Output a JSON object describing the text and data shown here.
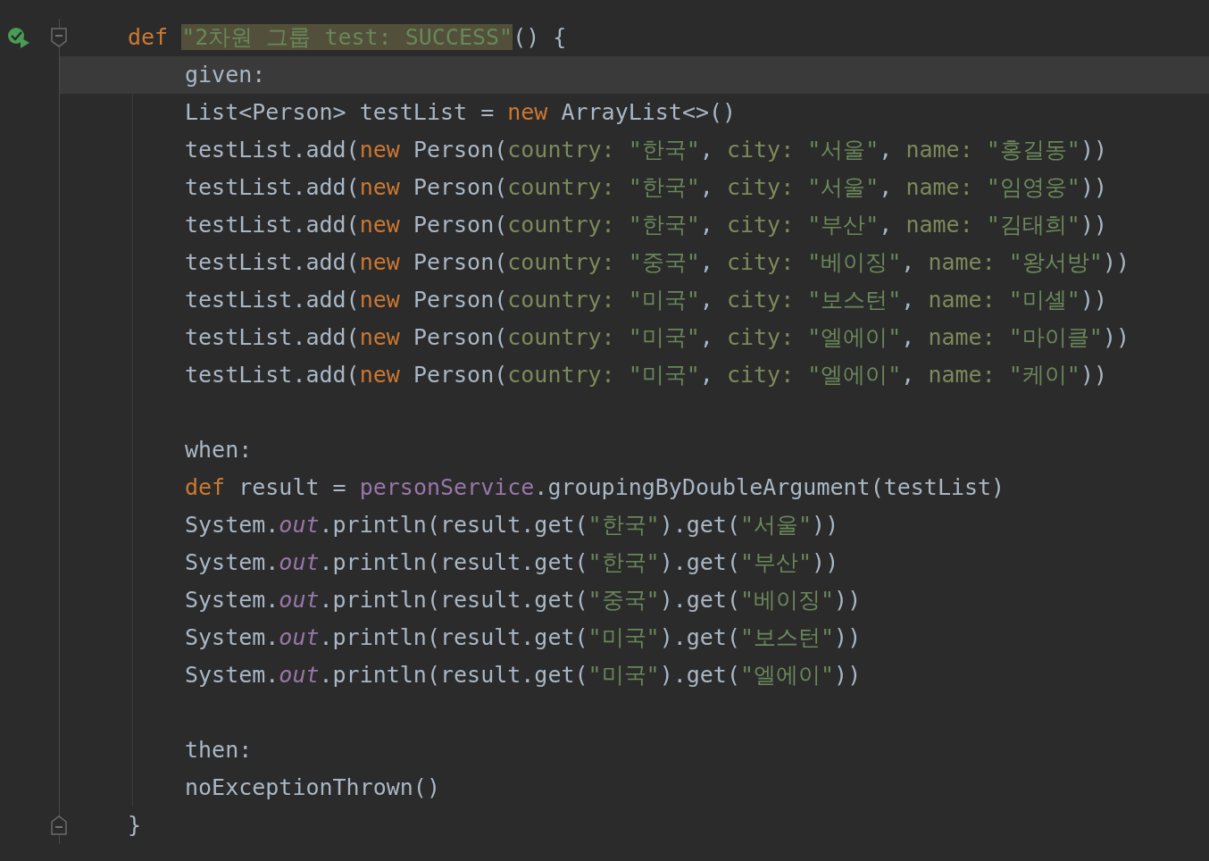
{
  "editor": {
    "lines": [
      {
        "kind": "block-start",
        "current": false,
        "tokens": [
          {
            "kind": "keyword",
            "text": "def"
          },
          {
            "kind": "highlighted-string",
            "text": "\"2차원 그룹 test: SUCCESS\""
          },
          {
            "kind": "plain",
            "text": "() {"
          }
        ],
        "children": [
          {
            "current": true,
            "tokens": [
              {
                "kind": "plain",
                "text": "given:"
              }
            ]
          },
          {
            "current": false,
            "tokens": [
              {
                "kind": "plain",
                "text": "List<Person> testList = "
              },
              {
                "kind": "keyword",
                "text": "new"
              },
              {
                "kind": "plain",
                "text": " ArrayList<>()"
              }
            ]
          },
          {
            "current": false,
            "tokens": [
              {
                "kind": "plain",
                "text": "testList.add("
              },
              {
                "kind": "keyword",
                "text": "new"
              },
              {
                "kind": "plain",
                "text": " Person("
              },
              {
                "kind": "param",
                "text": "country:"
              },
              {
                "kind": "string",
                "text": "\"한국\""
              },
              {
                "kind": "plain",
                "text": ", "
              },
              {
                "kind": "param",
                "text": "city:"
              },
              {
                "kind": "string",
                "text": "\"서울\""
              },
              {
                "kind": "plain",
                "text": ", "
              },
              {
                "kind": "param",
                "text": "name:"
              },
              {
                "kind": "string",
                "text": "\"홍길동\""
              },
              {
                "kind": "plain",
                "text": "))"
              }
            ]
          },
          {
            "current": false,
            "tokens": [
              {
                "kind": "plain",
                "text": "testList.add("
              },
              {
                "kind": "keyword",
                "text": "new"
              },
              {
                "kind": "plain",
                "text": " Person("
              },
              {
                "kind": "param",
                "text": "country:"
              },
              {
                "kind": "string",
                "text": "\"한국\""
              },
              {
                "kind": "plain",
                "text": ", "
              },
              {
                "kind": "param",
                "text": "city:"
              },
              {
                "kind": "string",
                "text": "\"서울\""
              },
              {
                "kind": "plain",
                "text": ", "
              },
              {
                "kind": "param",
                "text": "name:"
              },
              {
                "kind": "string",
                "text": "\"임영웅\""
              },
              {
                "kind": "plain",
                "text": "))"
              }
            ]
          },
          {
            "current": false,
            "tokens": [
              {
                "kind": "plain",
                "text": "testList.add("
              },
              {
                "kind": "keyword",
                "text": "new"
              },
              {
                "kind": "plain",
                "text": " Person("
              },
              {
                "kind": "param",
                "text": "country:"
              },
              {
                "kind": "string",
                "text": "\"한국\""
              },
              {
                "kind": "plain",
                "text": ", "
              },
              {
                "kind": "param",
                "text": "city:"
              },
              {
                "kind": "string",
                "text": "\"부산\""
              },
              {
                "kind": "plain",
                "text": ", "
              },
              {
                "kind": "param",
                "text": "name:"
              },
              {
                "kind": "string",
                "text": "\"김태희\""
              },
              {
                "kind": "plain",
                "text": "))"
              }
            ]
          },
          {
            "current": false,
            "tokens": [
              {
                "kind": "plain",
                "text": "testList.add("
              },
              {
                "kind": "keyword",
                "text": "new"
              },
              {
                "kind": "plain",
                "text": " Person("
              },
              {
                "kind": "param",
                "text": "country:"
              },
              {
                "kind": "string",
                "text": "\"중국\""
              },
              {
                "kind": "plain",
                "text": ", "
              },
              {
                "kind": "param",
                "text": "city:"
              },
              {
                "kind": "string",
                "text": "\"베이징\""
              },
              {
                "kind": "plain",
                "text": ", "
              },
              {
                "kind": "param",
                "text": "name:"
              },
              {
                "kind": "string",
                "text": "\"왕서방\""
              },
              {
                "kind": "plain",
                "text": "))"
              }
            ]
          },
          {
            "current": false,
            "tokens": [
              {
                "kind": "plain",
                "text": "testList.add("
              },
              {
                "kind": "keyword",
                "text": "new"
              },
              {
                "kind": "plain",
                "text": " Person("
              },
              {
                "kind": "param",
                "text": "country:"
              },
              {
                "kind": "string",
                "text": "\"미국\""
              },
              {
                "kind": "plain",
                "text": ", "
              },
              {
                "kind": "param",
                "text": "city:"
              },
              {
                "kind": "string",
                "text": "\"보스턴\""
              },
              {
                "kind": "plain",
                "text": ", "
              },
              {
                "kind": "param",
                "text": "name:"
              },
              {
                "kind": "string",
                "text": "\"미셸\""
              },
              {
                "kind": "plain",
                "text": "))"
              }
            ]
          },
          {
            "current": false,
            "tokens": [
              {
                "kind": "plain",
                "text": "testList.add("
              },
              {
                "kind": "keyword",
                "text": "new"
              },
              {
                "kind": "plain",
                "text": " Person("
              },
              {
                "kind": "param",
                "text": "country:"
              },
              {
                "kind": "string",
                "text": "\"미국\""
              },
              {
                "kind": "plain",
                "text": ", "
              },
              {
                "kind": "param",
                "text": "city:"
              },
              {
                "kind": "string",
                "text": "\"엘에이\""
              },
              {
                "kind": "plain",
                "text": ", "
              },
              {
                "kind": "param",
                "text": "name:"
              },
              {
                "kind": "string",
                "text": "\"마이클\""
              },
              {
                "kind": "plain",
                "text": "))"
              }
            ]
          },
          {
            "current": false,
            "tokens": [
              {
                "kind": "plain",
                "text": "testList.add("
              },
              {
                "kind": "keyword",
                "text": "new"
              },
              {
                "kind": "plain",
                "text": " Person("
              },
              {
                "kind": "param",
                "text": "country:"
              },
              {
                "kind": "string",
                "text": "\"미국\""
              },
              {
                "kind": "plain",
                "text": ", "
              },
              {
                "kind": "param",
                "text": "city:"
              },
              {
                "kind": "string",
                "text": "\"엘에이\""
              },
              {
                "kind": "plain",
                "text": ", "
              },
              {
                "kind": "param",
                "text": "name:"
              },
              {
                "kind": "string",
                "text": "\"케이\""
              },
              {
                "kind": "plain",
                "text": "))"
              }
            ]
          },
          {
            "current": false
          },
          {
            "current": false,
            "tokens": [
              {
                "kind": "plain",
                "text": "when:"
              }
            ]
          },
          {
            "current": false,
            "tokens": [
              {
                "kind": "keyword",
                "text": "def"
              },
              {
                "kind": "plain",
                "text": " result = "
              },
              {
                "kind": "field",
                "text": "personService"
              },
              {
                "kind": "plain",
                "text": ".groupingByDoubleArgument(testList)"
              }
            ]
          },
          {
            "current": false,
            "tokens": [
              {
                "kind": "plain",
                "text": "System."
              },
              {
                "kind": "static",
                "text": "out"
              },
              {
                "kind": "plain",
                "text": ".println(result.get("
              },
              {
                "kind": "string",
                "text": "\"한국\""
              },
              {
                "kind": "plain",
                "text": ").get("
              },
              {
                "kind": "string",
                "text": "\"서울\""
              },
              {
                "kind": "plain",
                "text": "))"
              }
            ]
          },
          {
            "current": false,
            "tokens": [
              {
                "kind": "plain",
                "text": "System."
              },
              {
                "kind": "static",
                "text": "out"
              },
              {
                "kind": "plain",
                "text": ".println(result.get("
              },
              {
                "kind": "string",
                "text": "\"한국\""
              },
              {
                "kind": "plain",
                "text": ").get("
              },
              {
                "kind": "string",
                "text": "\"부산\""
              },
              {
                "kind": "plain",
                "text": "))"
              }
            ]
          },
          {
            "current": false,
            "tokens": [
              {
                "kind": "plain",
                "text": "System."
              },
              {
                "kind": "static",
                "text": "out"
              },
              {
                "kind": "plain",
                "text": ".println(result.get("
              },
              {
                "kind": "string",
                "text": "\"중국\""
              },
              {
                "kind": "plain",
                "text": ").get("
              },
              {
                "kind": "string",
                "text": "\"베이징\""
              },
              {
                "kind": "plain",
                "text": "))"
              }
            ]
          },
          {
            "current": false,
            "tokens": [
              {
                "kind": "plain",
                "text": "System."
              },
              {
                "kind": "static",
                "text": "out"
              },
              {
                "kind": "plain",
                "text": ".println(result.get("
              },
              {
                "kind": "string",
                "text": "\"미국\""
              },
              {
                "kind": "plain",
                "text": ").get("
              },
              {
                "kind": "string",
                "text": "\"보스턴\""
              },
              {
                "kind": "plain",
                "text": "))"
              }
            ]
          },
          {
            "current": false,
            "tokens": [
              {
                "kind": "plain",
                "text": "System."
              },
              {
                "kind": "static",
                "text": "out"
              },
              {
                "kind": "plain",
                "text": ".println(result.get("
              },
              {
                "kind": "string",
                "text": "\"미국\""
              },
              {
                "kind": "plain",
                "text": ").get("
              },
              {
                "kind": "string",
                "text": "\"엘에이\""
              },
              {
                "kind": "plain",
                "text": "))"
              }
            ]
          },
          {
            "current": false
          },
          {
            "current": false,
            "tokens": [
              {
                "kind": "plain",
                "text": "then:"
              }
            ]
          },
          {
            "current": false,
            "tokens": [
              {
                "kind": "plain",
                "text": "noExceptionThrown()"
              }
            ]
          }
        ]
      },
      {
        "kind": "block-end",
        "current": false,
        "tokens": [
          {
            "kind": "plain",
            "text": "}"
          }
        ]
      }
    ]
  }
}
